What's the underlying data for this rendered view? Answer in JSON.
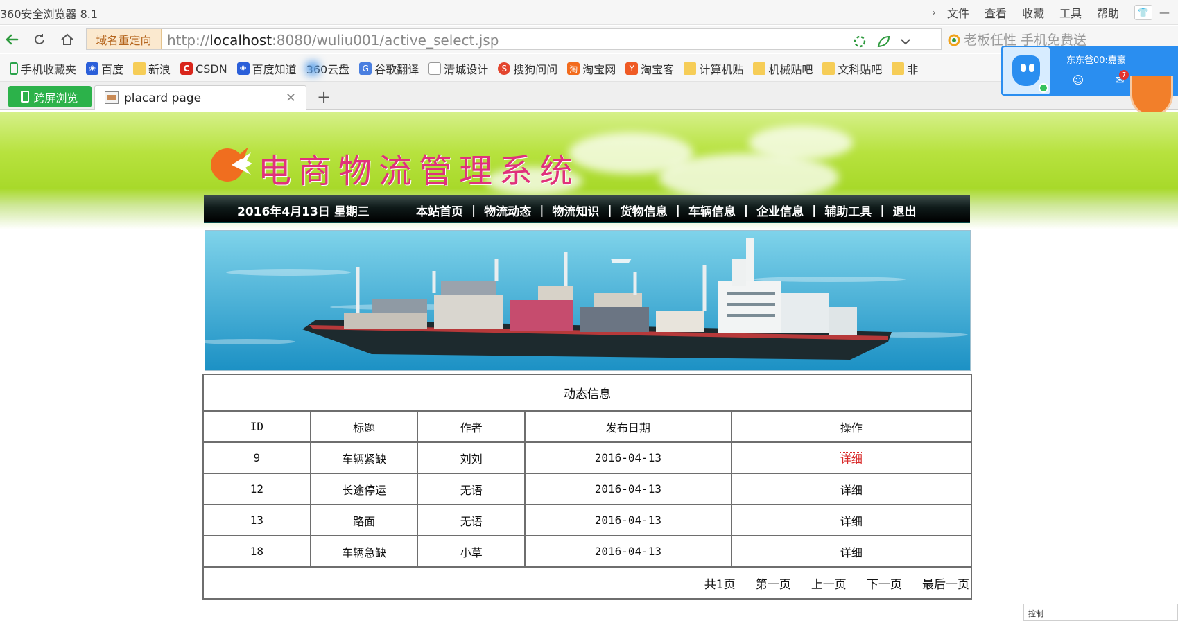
{
  "browser": {
    "app_title": "360安全浏览器 8.1",
    "menus": [
      "文件",
      "查看",
      "收藏",
      "工具",
      "帮助"
    ],
    "redirect_label": "域名重定向",
    "url_prefix": "http://",
    "url_host": "localhost",
    "url_rest": ":8080/wuliu001/active_select.jsp",
    "search_hint": "老板任性 手机免费送",
    "bookmarks": [
      {
        "label": "手机收藏夹",
        "icon": "phone-icon"
      },
      {
        "label": "百度",
        "icon": "baidu-icon"
      },
      {
        "label": "新浪",
        "icon": "folder-icon"
      },
      {
        "label": "CSDN",
        "icon": "csdn-icon"
      },
      {
        "label": "百度知道",
        "icon": "baidu-icon"
      },
      {
        "label": "360云盘",
        "icon": "cloud-icon"
      },
      {
        "label": "谷歌翻译",
        "icon": "translate-icon"
      },
      {
        "label": "清城设计",
        "icon": "document-icon"
      },
      {
        "label": "搜狗问问",
        "icon": "sogou-icon"
      },
      {
        "label": "淘宝网",
        "icon": "taobao-icon"
      },
      {
        "label": "淘宝客",
        "icon": "taobaoke-icon"
      },
      {
        "label": "计算机贴",
        "icon": "folder-icon"
      },
      {
        "label": "机械贴吧",
        "icon": "folder-icon"
      },
      {
        "label": "文科贴吧",
        "icon": "folder-icon"
      },
      {
        "label": "非",
        "icon": "folder-icon"
      }
    ],
    "cross_screen_label": "跨屏浏览",
    "tab_title": "placard page",
    "popup_name": "东东爸00:嘉豪",
    "mail_badge": "7",
    "status_text": "控制"
  },
  "site": {
    "logo_text": "电商物流管理系统",
    "date_text": "2016年4月13日  星期三",
    "nav": [
      "本站首页",
      "物流动态",
      "物流知识",
      "货物信息",
      "车辆信息",
      "企业信息",
      "辅助工具",
      "退出"
    ]
  },
  "table": {
    "caption": "动态信息",
    "headers": [
      "ID",
      "标题",
      "作者",
      "发布日期",
      "操作"
    ],
    "rows": [
      {
        "id": "9",
        "title": "车辆紧缺",
        "author": "刘刘",
        "date": "2016-04-13",
        "action": "详细"
      },
      {
        "id": "12",
        "title": "长途停运",
        "author": "无语",
        "date": "2016-04-13",
        "action": "详细"
      },
      {
        "id": "13",
        "title": "路面",
        "author": "无语",
        "date": "2016-04-13",
        "action": "详细"
      },
      {
        "id": "18",
        "title": "车辆急缺",
        "author": "小草",
        "date": "2016-04-13",
        "action": "详细"
      }
    ],
    "pager": {
      "total": "共1页",
      "first": "第一页",
      "prev": "上一页",
      "next": "下一页",
      "last": "最后一页"
    }
  },
  "colors": {
    "accent_green": "#2cb24a",
    "logo_pink": "#e0317b",
    "banner_green": "#a8d92a",
    "popup_blue": "#2a8ef0"
  }
}
